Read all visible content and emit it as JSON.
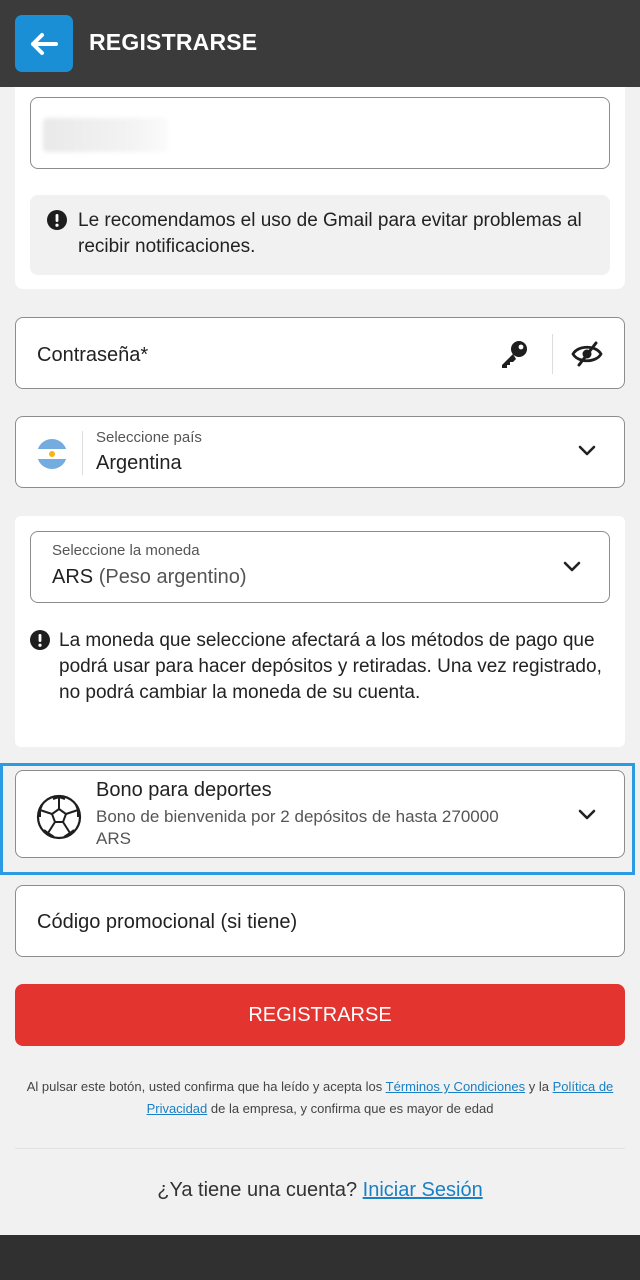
{
  "header": {
    "title": "REGISTRARSE",
    "back_icon": "arrow-left-icon"
  },
  "email": {
    "hint": "Le recomendamos el uso de Gmail para evitar problemas al recibir notificaciones."
  },
  "password": {
    "label": "Contraseña*",
    "key_icon": "key-icon",
    "visibility_icon": "eye-off-icon"
  },
  "country": {
    "label": "Seleccione país",
    "value": "Argentina",
    "flag_icon": "argentina-flag-icon"
  },
  "currency": {
    "label": "Seleccione la moneda",
    "code": "ARS",
    "name": "(Peso argentino)",
    "note": "La moneda que seleccione afectará a los métodos de pago que podrá usar para hacer depósitos y retiradas. Una vez registrado, no podrá cambiar la moneda de su cuenta."
  },
  "bonus": {
    "title": "Bono para deportes",
    "subtitle": "Bono de bienvenida por 2 depósitos de hasta 270000 ARS",
    "icon": "soccer-ball-icon"
  },
  "promo": {
    "label": "Código promocional (si tiene)"
  },
  "submit": {
    "label": "REGISTRARSE"
  },
  "legal": {
    "part1": "Al pulsar este botón, usted confirma que ha leído y acepta los ",
    "terms_link": "Términos y Condiciones",
    "part2": " y la ",
    "privacy_link": "Política de Privacidad",
    "part3": " de la empresa, y confirma que es mayor de edad"
  },
  "login": {
    "question": "¿Ya tiene una cuenta? ",
    "link": "Iniciar Sesión"
  },
  "colors": {
    "accent": "#1a8fd6",
    "danger": "#e3342f",
    "header_bg": "#3b3b3b",
    "focus_outline": "#2b9be3"
  }
}
